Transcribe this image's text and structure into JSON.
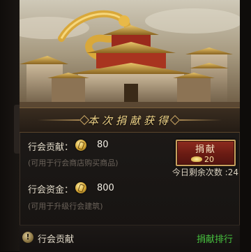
{
  "banner": {
    "title": "本次捐献获得"
  },
  "contribution": {
    "label": "行会贡献：",
    "value": "80",
    "hint": "(可用于行会商店购买商品)",
    "icon": "contribution-coin-icon"
  },
  "funds": {
    "label": "行会资金：",
    "value": "800",
    "hint": "(可用于升级行会建筑)",
    "icon": "funds-coin-icon"
  },
  "donate": {
    "button_label": "捐献",
    "cost": "20",
    "cost_icon": "gold-ingot-icon",
    "remaining": "今日剩余次数 :24"
  },
  "footer": {
    "help_glyph": "!",
    "label": "行会贡献",
    "rank_link": "捐献排行"
  },
  "colors": {
    "accent_gold": "#f0d488",
    "button_red": "#8e2b1f",
    "link_green": "#47c23f"
  }
}
